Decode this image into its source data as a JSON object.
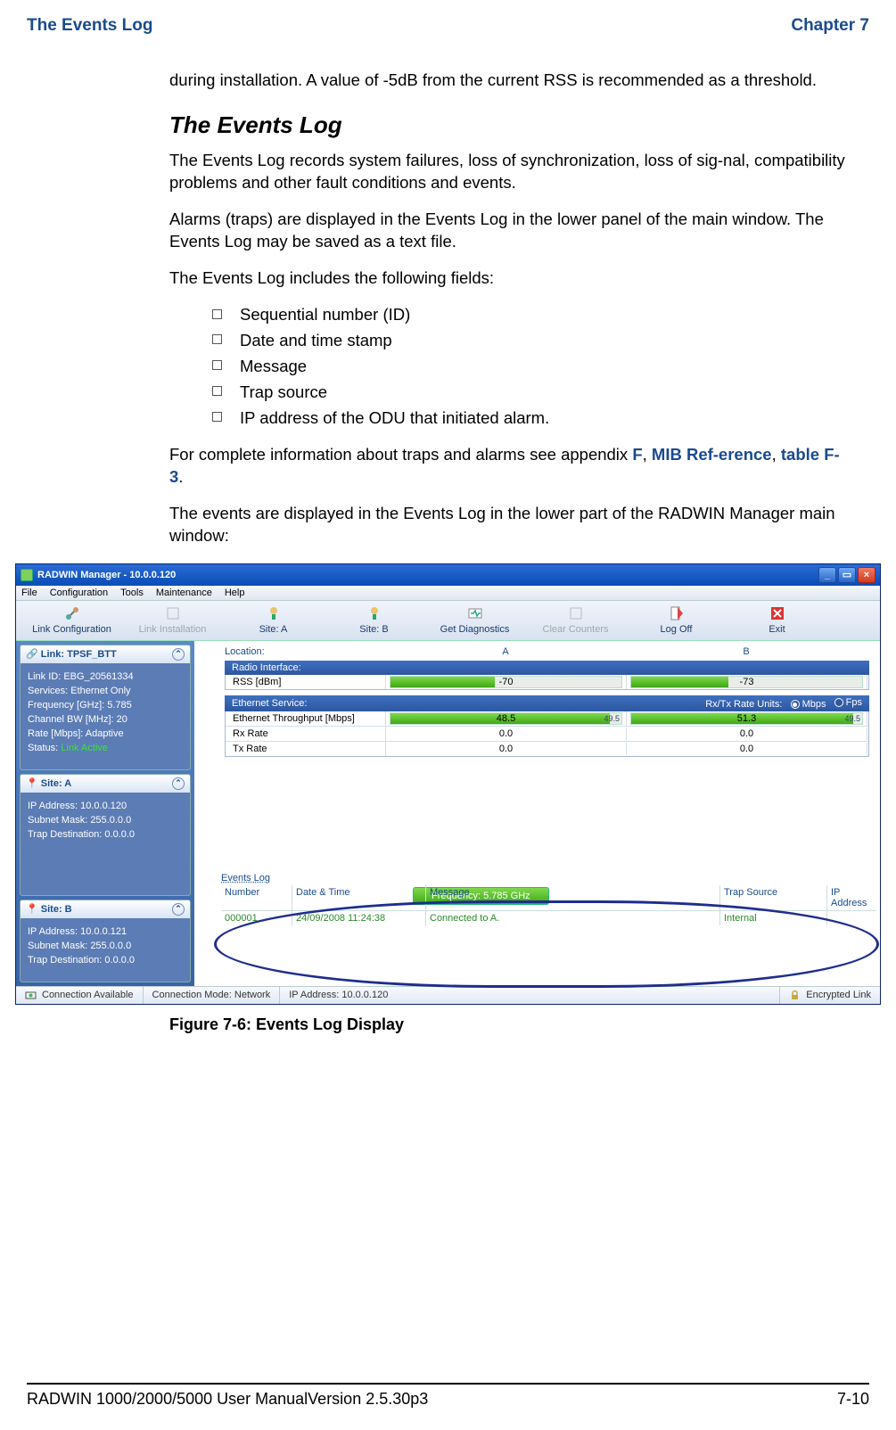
{
  "header": {
    "left": "The Events Log",
    "right": "Chapter 7"
  },
  "intro_para": "during installation. A value of -5dB from the current RSS is recommended as a threshold.",
  "section_title": "The Events Log",
  "para1": "The Events Log records system failures, loss of synchronization, loss of sig-nal, compatibility problems and other fault conditions and events.",
  "para2": "Alarms (traps) are displayed in the Events Log in the lower panel of the main window. The Events Log may be saved as a text file.",
  "para3": "The Events Log includes the following fields:",
  "fields": [
    "Sequential number (ID)",
    "Date and time stamp",
    "Message",
    "Trap source",
    "IP address of the ODU that initiated alarm."
  ],
  "para4_pre": "For complete information about traps and alarms see appendix ",
  "para4_link1": "F",
  "para4_mid": ", ",
  "para4_link2": "MIB Ref-erence",
  "para4_mid2": ", ",
  "para4_link3": "table F-3",
  "para4_end": ".",
  "para5": "The events are displayed in the Events Log in the lower part of the RADWIN Manager main window:",
  "app": {
    "titlebar": "RADWIN Manager - 10.0.0.120",
    "menu": [
      "File",
      "Configuration",
      "Tools",
      "Maintenance",
      "Help"
    ],
    "toolbar": [
      {
        "label": "Link Configuration",
        "disabled": false
      },
      {
        "label": "Link Installation",
        "disabled": true
      },
      {
        "label": "Site: A",
        "disabled": false
      },
      {
        "label": "Site: B",
        "disabled": false
      },
      {
        "label": "Get Diagnostics",
        "disabled": false
      },
      {
        "label": "Clear Counters",
        "disabled": true
      },
      {
        "label": "Log Off",
        "disabled": false
      },
      {
        "label": "Exit",
        "disabled": false
      }
    ],
    "sidebar": {
      "link": {
        "title": "Link: TPSF_BTT",
        "rows": [
          "Link ID:  EBG_20561334",
          "Services:  Ethernet Only",
          "Frequency [GHz]:  5.785",
          "Channel BW [MHz]:  20",
          "Rate [Mbps]:  Adaptive"
        ],
        "status_label": "Status:  ",
        "status_value": "Link Active"
      },
      "siteA": {
        "title": "Site: A",
        "rows": [
          "IP Address:  10.0.0.120",
          "Subnet Mask:  255.0.0.0",
          "Trap Destination:  0.0.0.0"
        ]
      },
      "siteB": {
        "title": "Site: B",
        "rows": [
          "IP Address:  10.0.0.121",
          "Subnet Mask:  255.0.0.0",
          "Trap Destination:  0.0.0.0"
        ]
      }
    },
    "main": {
      "location_label": "Location:",
      "colA": "A",
      "colB": "B",
      "radio_panel": "Radio Interface:",
      "rss_label": "RSS [dBm]",
      "rss_A": "-70",
      "rss_B": "-73",
      "eth_panel": "Ethernet Service:",
      "rate_units_label": "Rx/Tx Rate Units:",
      "rate_opt1": "Mbps",
      "rate_opt2": "Fps",
      "thr_label": "Ethernet Throughput [Mbps]",
      "thr_A": "48.5",
      "thr_A_end": "49.5",
      "thr_B": "51.3",
      "thr_B_end": "49.5",
      "rx_label": "Rx Rate",
      "rx_A": "0.0",
      "rx_B": "0.0",
      "tx_label": "Tx Rate",
      "tx_A": "0.0",
      "tx_B": "0.0",
      "freq_badge": "Frequency: 5.785 GHz",
      "events_title": "Events Log",
      "ev_cols": {
        "num": "Number",
        "dt": "Date & Time",
        "msg": "Message",
        "src": "Trap Source",
        "ip": "IP Address"
      },
      "ev_row": {
        "num": "000001",
        "dt": "24/09/2008 11:24:38",
        "msg": "Connected to A.",
        "src": "Internal",
        "ip": ""
      }
    },
    "statusbar": {
      "conn": "Connection Available",
      "mode": "Connection Mode: Network",
      "ip": "IP Address: 10.0.0.120",
      "enc": "Encrypted Link"
    }
  },
  "figure_caption": "Figure 7-6: Events Log Display",
  "footer": {
    "left": "RADWIN 1000/2000/5000 User ManualVersion  2.5.30p3",
    "right": "7-10"
  }
}
